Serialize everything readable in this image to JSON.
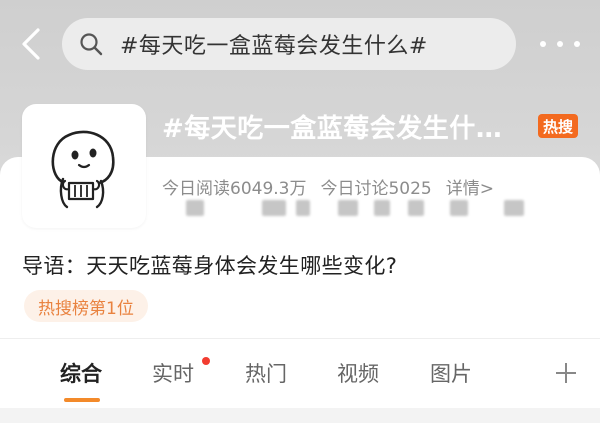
{
  "search": {
    "query": "#每天吃一盒蓝莓会发生什么#"
  },
  "topic": {
    "title": "#每天吃一盒蓝莓会发生什…",
    "hot_badge": "热搜",
    "reads": "今日阅读6049.3万",
    "discussions": "今日讨论5025",
    "details_link": "详情>",
    "intro": "导语：天天吃蓝莓身体会发生哪些变化?",
    "rank": "热搜榜第1位"
  },
  "tabs": [
    {
      "label": "综合",
      "active": true
    },
    {
      "label": "实时",
      "has_dot": true
    },
    {
      "label": "热门"
    },
    {
      "label": "视频"
    },
    {
      "label": "图片"
    }
  ],
  "colors": {
    "accent": "#f38a2a",
    "hot_badge": "#f36a1f",
    "red_dot": "#f23c30"
  },
  "icons": {
    "back": "chevron-left-icon",
    "search": "search-icon",
    "more": "more-dots-icon",
    "add": "plus-icon"
  }
}
